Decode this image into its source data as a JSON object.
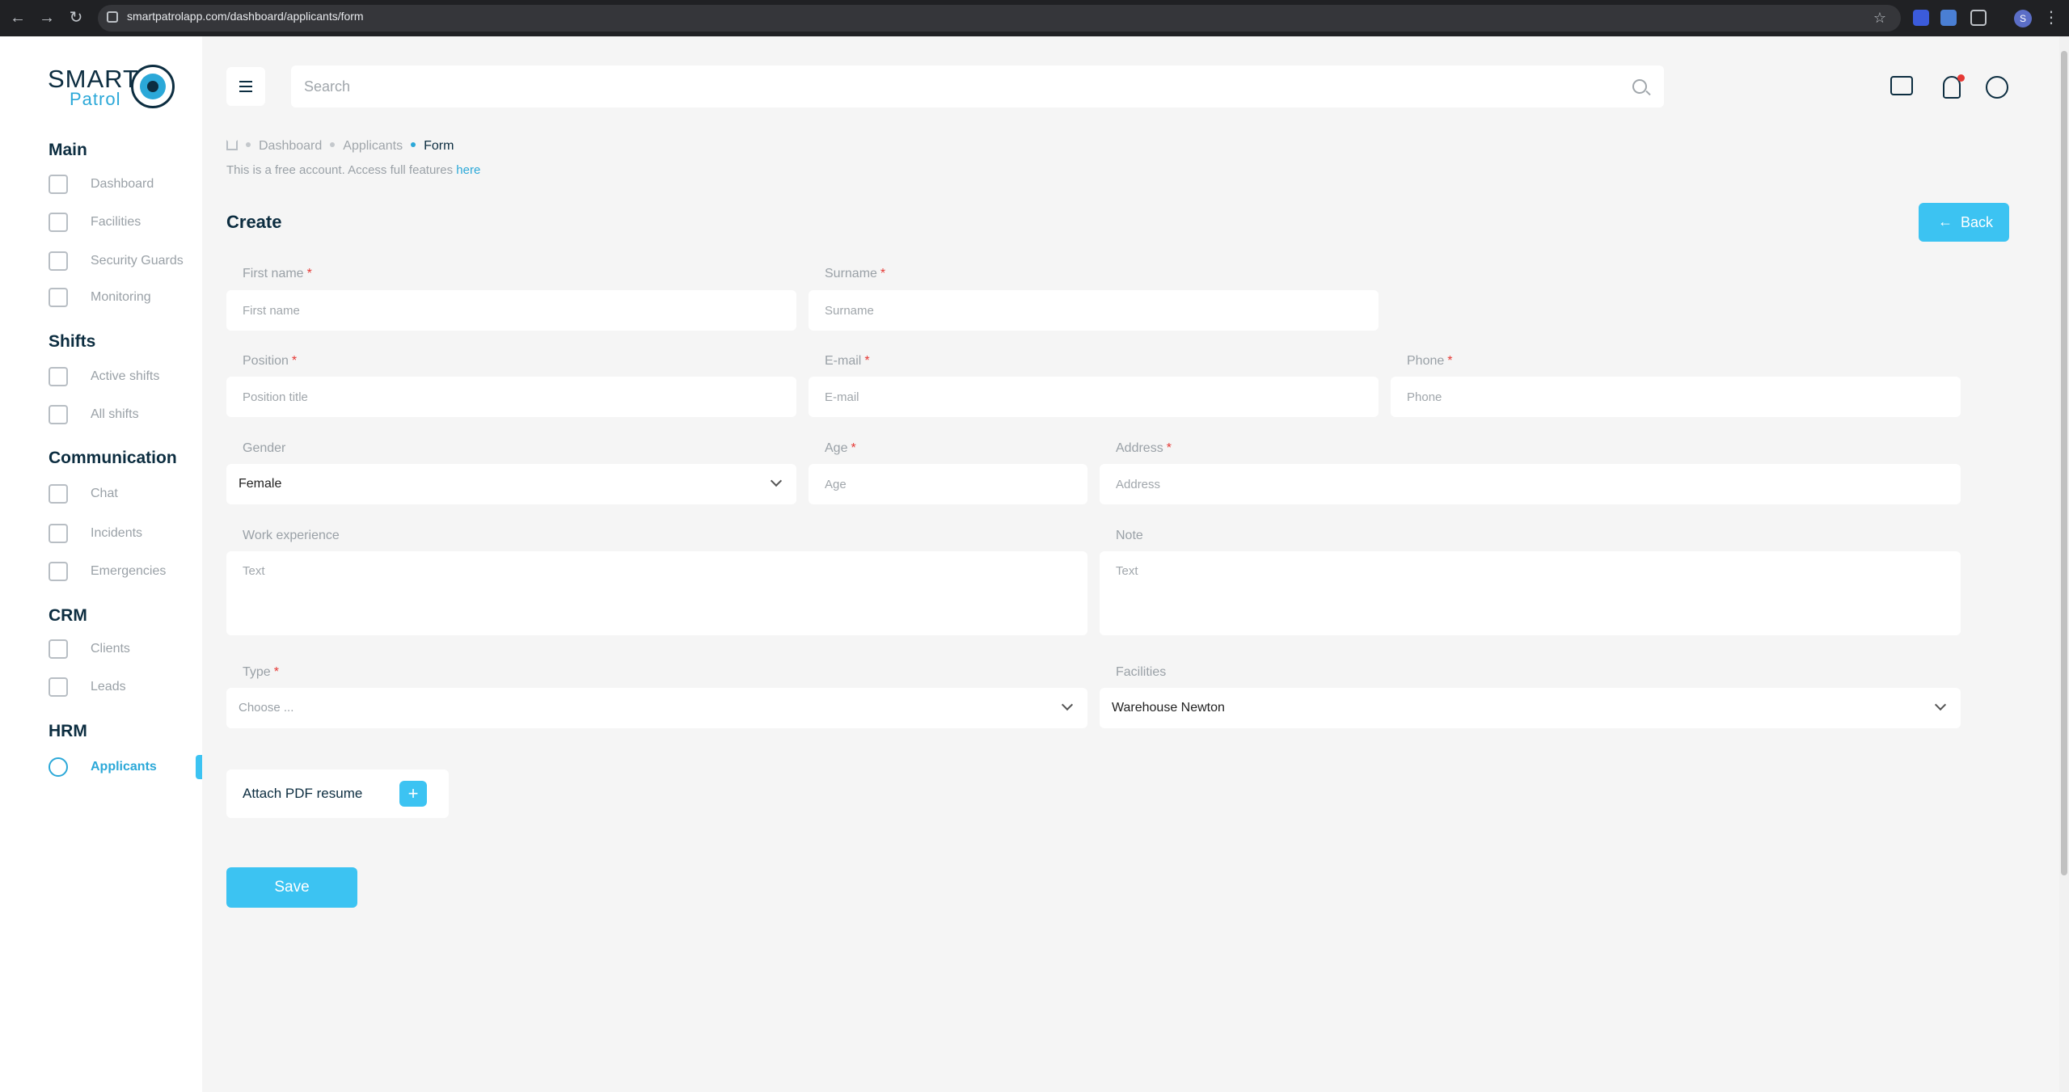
{
  "browser": {
    "url": "smartpatrolapp.com/dashboard/applicants/form",
    "profile_initial": "S"
  },
  "logo": {
    "line1": "SMART",
    "line2": "Patrol"
  },
  "sidebar": {
    "sections": [
      {
        "title": "Main",
        "items": [
          {
            "label": "Dashboard",
            "icon": "grid-icon"
          },
          {
            "label": "Facilities",
            "icon": "building-icon"
          },
          {
            "label": "Security Guards",
            "icon": "guard-icon"
          },
          {
            "label": "Monitoring",
            "icon": "monitor-icon"
          }
        ]
      },
      {
        "title": "Shifts",
        "items": [
          {
            "label": "Active shifts",
            "icon": "hand-icon"
          },
          {
            "label": "All shifts",
            "icon": "calendar-icon"
          }
        ]
      },
      {
        "title": "Communication",
        "items": [
          {
            "label": "Chat",
            "icon": "chat-icon"
          },
          {
            "label": "Incidents",
            "icon": "alert-icon"
          },
          {
            "label": "Emergencies",
            "icon": "siren-icon"
          }
        ]
      },
      {
        "title": "CRM",
        "items": [
          {
            "label": "Clients",
            "icon": "clients-icon"
          },
          {
            "label": "Leads",
            "icon": "leads-icon"
          }
        ]
      },
      {
        "title": "HRM",
        "items": [
          {
            "label": "Applicants",
            "icon": "applicant-icon",
            "active": true
          }
        ]
      }
    ]
  },
  "topbar": {
    "search_placeholder": "Search"
  },
  "breadcrumb": {
    "items": [
      "Dashboard",
      "Applicants",
      "Form"
    ]
  },
  "notice": {
    "text": "This is a free account. Access full features ",
    "link": "here"
  },
  "page": {
    "title": "Create",
    "back_label": "Back"
  },
  "form": {
    "first_name": {
      "label": "First name",
      "placeholder": "First name"
    },
    "surname": {
      "label": "Surname",
      "placeholder": "Surname"
    },
    "position": {
      "label": "Position",
      "placeholder": "Position title"
    },
    "email": {
      "label": "E-mail",
      "placeholder": "E-mail"
    },
    "phone": {
      "label": "Phone",
      "placeholder": "Phone"
    },
    "gender": {
      "label": "Gender",
      "value": "Female"
    },
    "age": {
      "label": "Age",
      "placeholder": "Age"
    },
    "address": {
      "label": "Address",
      "placeholder": "Address"
    },
    "work_experience": {
      "label": "Work experience",
      "placeholder": "Text"
    },
    "note": {
      "label": "Note",
      "placeholder": "Text"
    },
    "type": {
      "label": "Type",
      "placeholder": "Choose ..."
    },
    "facilities": {
      "label": "Facilities",
      "value": "Warehouse Newton"
    },
    "attach_label": "Attach PDF resume",
    "attach_plus": "+",
    "save_label": "Save"
  },
  "colors": {
    "accent": "#3cc3f2",
    "brand_dark": "#0c2d40",
    "required": "#e53935"
  }
}
